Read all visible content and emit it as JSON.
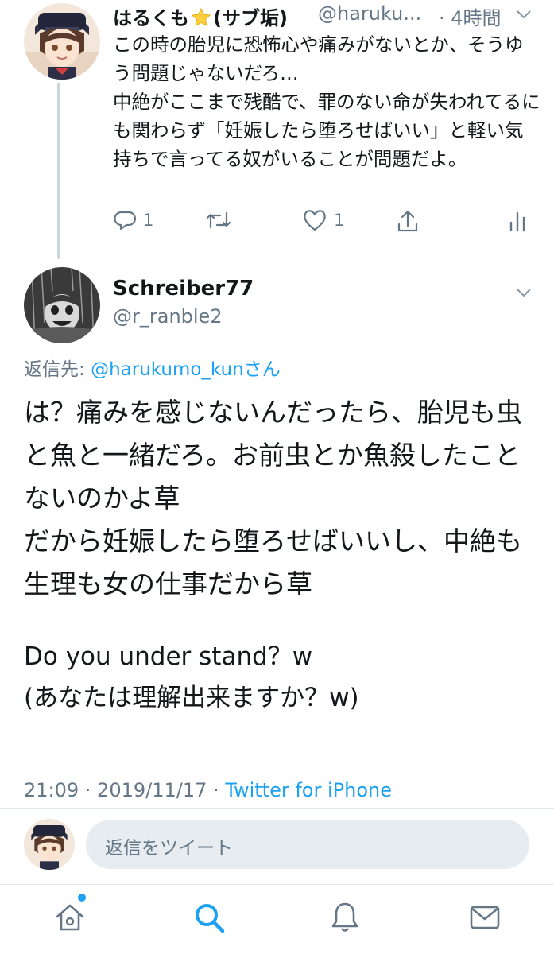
{
  "colors": {
    "accent": "#1da1f2",
    "secondary_text": "#657786",
    "primary_text": "#14171a",
    "divider": "#e1e8ed",
    "reply_box_bg": "#e6ecf0",
    "star": "#ffcf3f"
  },
  "parent_tweet": {
    "name": "はるくも",
    "name_suffix": "(サブ垢)",
    "name_emoji": "star-icon",
    "handle": "@haruku...",
    "time": "· 4時間",
    "body": "この時の胎児に恐怖心や痛みがないとか、そうゆう問題じゃないだろ…\n中絶がここまで残酷で、罪のない命が失われてるにも関わらず「妊娠したら堕ろせばいい」と軽い気持ちで言ってる奴がいることが問題だよ。",
    "actions": {
      "reply_count": "1",
      "retweet_count": "",
      "like_count": "1"
    }
  },
  "main_tweet": {
    "name": "Schreiber77",
    "handle": "@r_ranble2",
    "reply_to_label": "返信先: ",
    "reply_to_mention": "@harukumo_kunさん",
    "body": "は？痛みを感じないんだったら、胎児も虫と魚と一緒だろ。お前虫とか魚殺したことないのかよ草\nだから妊娠したら堕ろせばいいし、中絶も生理も女の仕事だから草",
    "body_en": "Do you under stand？w\n(あなたは理解出来ますか？w)",
    "time": "21:09 · 2019/11/17 · ",
    "source": "Twitter for iPhone"
  },
  "reply_bar": {
    "placeholder": "返信をツイート"
  },
  "tab_bar": {
    "items": [
      "home-icon",
      "search-icon",
      "notifications-icon",
      "messages-icon"
    ],
    "active": "search-icon"
  }
}
